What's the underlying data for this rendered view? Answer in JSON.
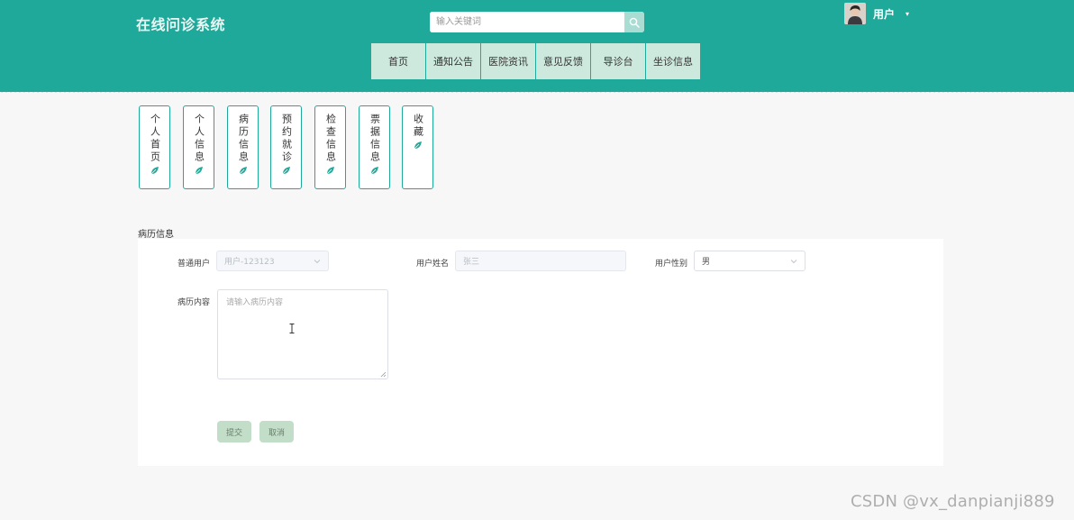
{
  "site": {
    "title": "在线问诊系统"
  },
  "search": {
    "placeholder": "输入关键词",
    "icon": "search-icon"
  },
  "user": {
    "name": "用户",
    "caret": "▾"
  },
  "nav": {
    "items": [
      "首页",
      "通知公告",
      "医院资讯",
      "意见反馈",
      "导诊台",
      "坐诊信息"
    ]
  },
  "side_tabs": {
    "items": [
      "个人首页",
      "个人信息",
      "病历信息",
      "预约就诊",
      "检查信息",
      "票据信息",
      "收藏"
    ]
  },
  "form": {
    "section_title": "病历信息",
    "fields": {
      "account": {
        "label": "普通用户",
        "value": "用户-123123"
      },
      "name": {
        "label": "用户姓名",
        "value": "张三"
      },
      "gender": {
        "label": "用户性别",
        "value": "男"
      },
      "content": {
        "label": "病历内容",
        "placeholder": "请输入病历内容"
      }
    },
    "buttons": {
      "submit": "提交",
      "cancel": "取消"
    }
  },
  "watermark": "CSDN @vx_danpianji889",
  "colors": {
    "header": "#1fa99a",
    "nav_item": "#cde9dd",
    "button": "#c2dec8",
    "tab_border": "#1fa99a"
  }
}
